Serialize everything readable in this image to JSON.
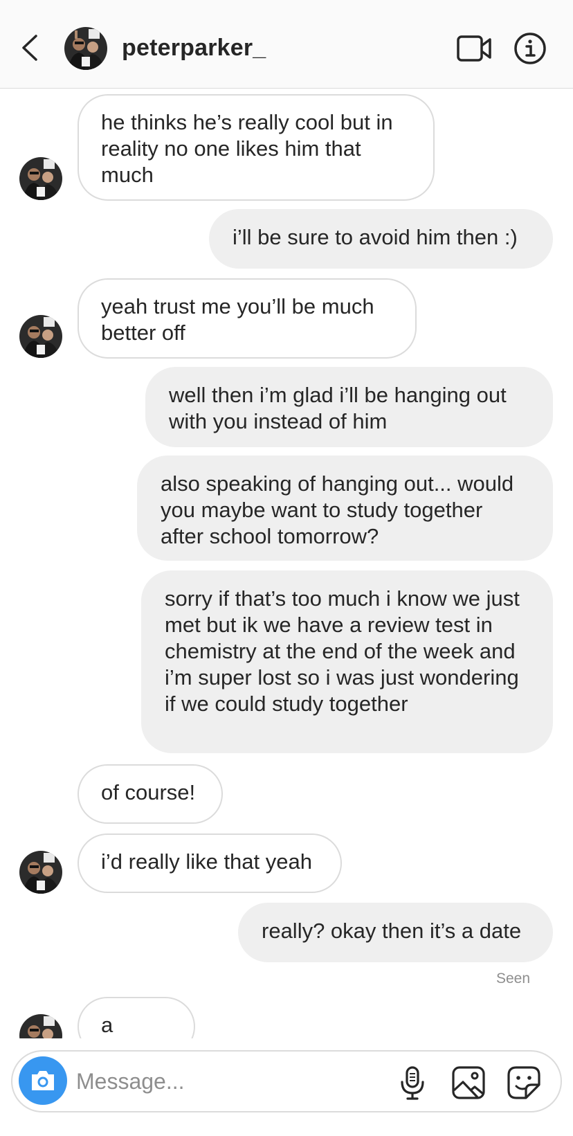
{
  "header": {
    "username": "peterparker_",
    "back_icon": "chevron-left-icon",
    "video_icon": "video-camera-icon",
    "info_icon": "info-icon"
  },
  "messages": [
    {
      "direction": "in",
      "text": "he thinks he’s really cool but in reality no one likes him that much",
      "avatar": true
    },
    {
      "direction": "out",
      "text": "i’ll be sure to avoid him then :)"
    },
    {
      "direction": "in",
      "text": "yeah trust me you’ll be much better off",
      "avatar": true
    },
    {
      "direction": "out",
      "text": "well then i’m glad i’ll be hanging out with you instead of him"
    },
    {
      "direction": "out",
      "text": "also speaking of hanging out... would you maybe want to study together after school tomorrow?"
    },
    {
      "direction": "out",
      "text": "sorry if that’s too much i know we just met but ik we have a review test in chemistry at the end of the week and i’m super lost so i was just wondering if we could study together"
    },
    {
      "direction": "in",
      "text": "of course!",
      "avatar": false
    },
    {
      "direction": "in",
      "text": "i’d really like that yeah",
      "avatar": true
    },
    {
      "direction": "out",
      "text": "really? okay then it’s a date"
    },
    {
      "direction": "in",
      "text": "a date?",
      "avatar": true
    }
  ],
  "seen_label": "Seen",
  "composer": {
    "placeholder": "Message...",
    "camera_icon": "camera-icon",
    "mic_icon": "microphone-icon",
    "gallery_icon": "gallery-icon",
    "sticker_icon": "sticker-icon"
  },
  "colors": {
    "accent": "#3897f0",
    "outgoing_bubble": "#efefef",
    "incoming_border": "#dbdbdb",
    "text": "#262626",
    "muted": "#8e8e8e"
  }
}
